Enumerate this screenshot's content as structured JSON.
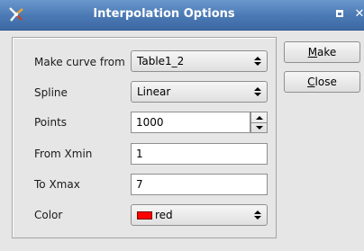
{
  "window": {
    "title": "Interpolation Options",
    "icon": "app-logo-icon",
    "controls": {
      "maximize_icon": "maximize-icon",
      "close_icon": "close-icon"
    }
  },
  "form": {
    "make_curve_from": {
      "label": "Make curve from",
      "value": "Table1_2"
    },
    "spline": {
      "label": "Spline",
      "value": "Linear"
    },
    "points": {
      "label": "Points",
      "value": "1000"
    },
    "from_xmin": {
      "label": "From Xmin",
      "value": "1"
    },
    "to_xmax": {
      "label": "To Xmax",
      "value": "7"
    },
    "color": {
      "label": "Color",
      "value": "red",
      "swatch_color": "#ff0000"
    }
  },
  "buttons": {
    "make": {
      "mnemonic": "M",
      "rest": "ake"
    },
    "close": {
      "mnemonic": "C",
      "rest": "lose"
    }
  },
  "colors": {
    "titlebar": "#4a78b3",
    "background": "#e6e6e6"
  }
}
